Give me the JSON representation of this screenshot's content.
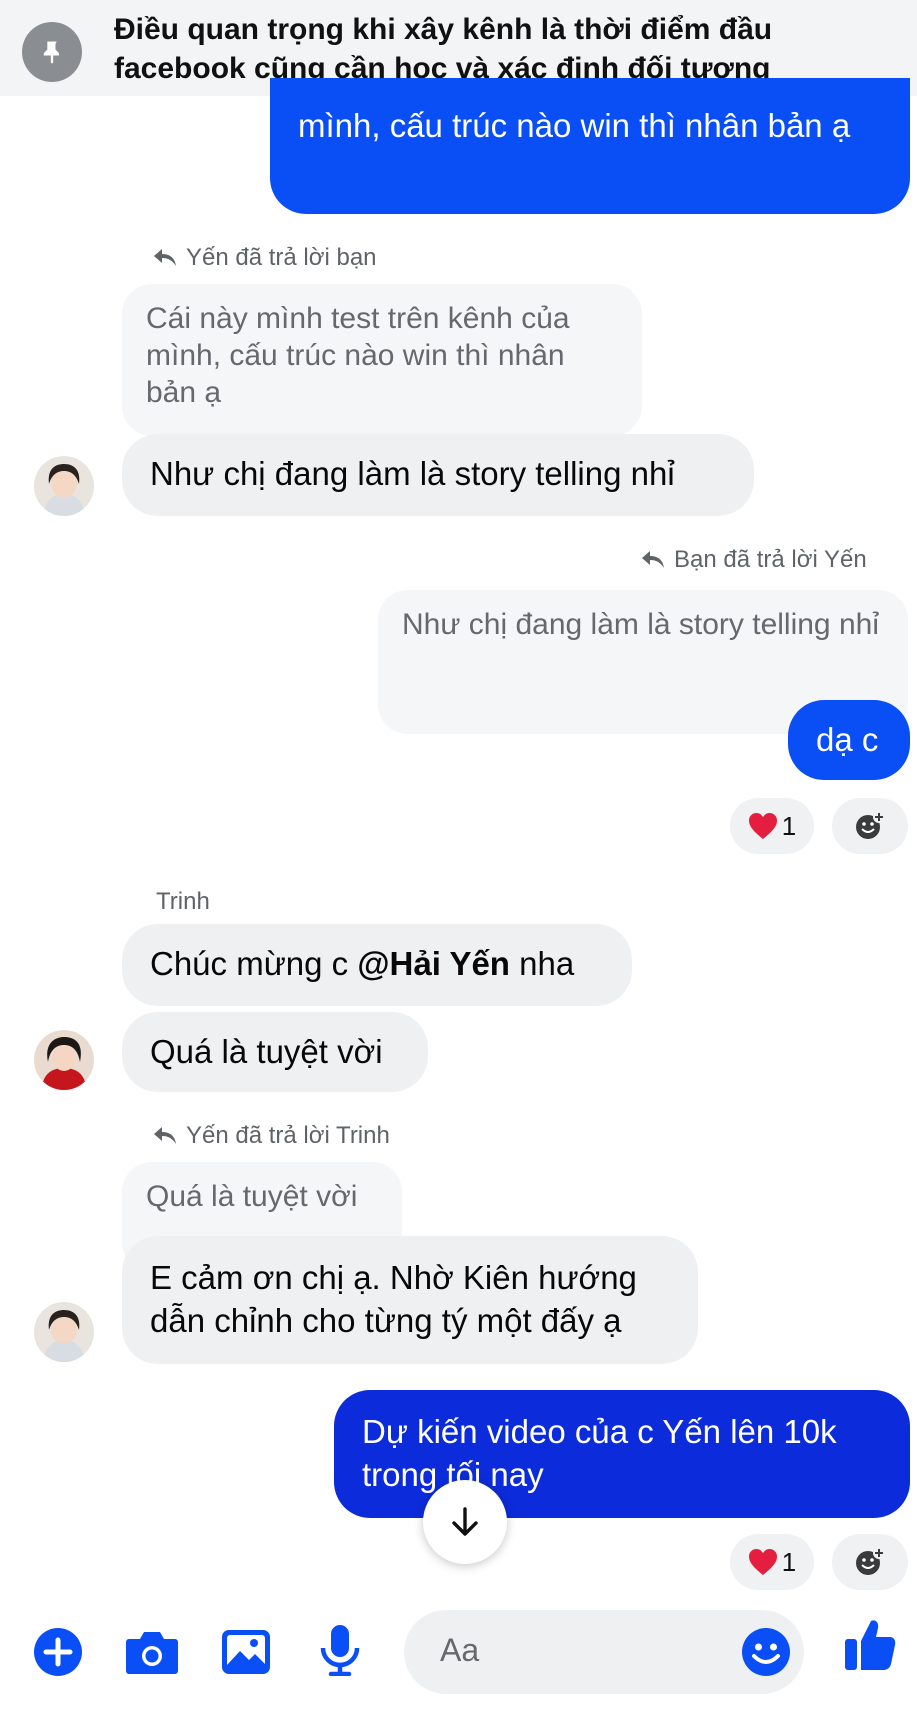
{
  "pinned": {
    "text": "Điều quan trọng khi xây kênh là thời điểm đầu facebook cũng cần học và xác định đối tượng"
  },
  "messages": {
    "m1_outgoing": "mình, cấu trúc nào win thì nhân bản ạ",
    "m2_reply_note": "Yến đã trả lời bạn",
    "m2_quoted": "Cái này mình test trên kênh của mình, cấu trúc nào win thì nhân bản ạ",
    "m2_text": "Như chị đang làm là story telling nhỉ",
    "m3_reply_note": "Bạn đã trả lời Yến",
    "m3_quoted": "Như chị đang làm là story telling nhỉ",
    "m3_text": "dạ c",
    "m3_reaction_count": "1",
    "m4_sender": "Trinh",
    "m4_text_prefix": "Chúc mừng c ",
    "m4_mention": "@Hải Yến",
    "m4_text_suffix": " nha",
    "m5_text": "Quá là tuyệt vời",
    "m6_reply_note": "Yến đã trả lời Trinh",
    "m6_quoted": "Quá là tuyệt vời",
    "m6_text": "E cảm ơn chị ạ. Nhờ Kiên hướng dẫn chỉnh cho từng tý một đấy ạ",
    "m7_text": "Dự kiến video của c Yến lên 10k trong tối nay",
    "m7_reaction_count": "1"
  },
  "composer": {
    "placeholder": "Aa"
  },
  "colors": {
    "accent": "#0a4ef5",
    "accent_dark": "#0c2bdb",
    "incoming_bubble": "#eff0f2",
    "heart": "#e41e3f"
  },
  "icons": [
    "pin-icon",
    "reply-arrow-icon",
    "heart-icon",
    "add-reaction-icon",
    "arrow-down-icon",
    "plus-icon",
    "camera-icon",
    "gallery-icon",
    "microphone-icon",
    "emoji-icon",
    "thumbs-up-icon"
  ]
}
